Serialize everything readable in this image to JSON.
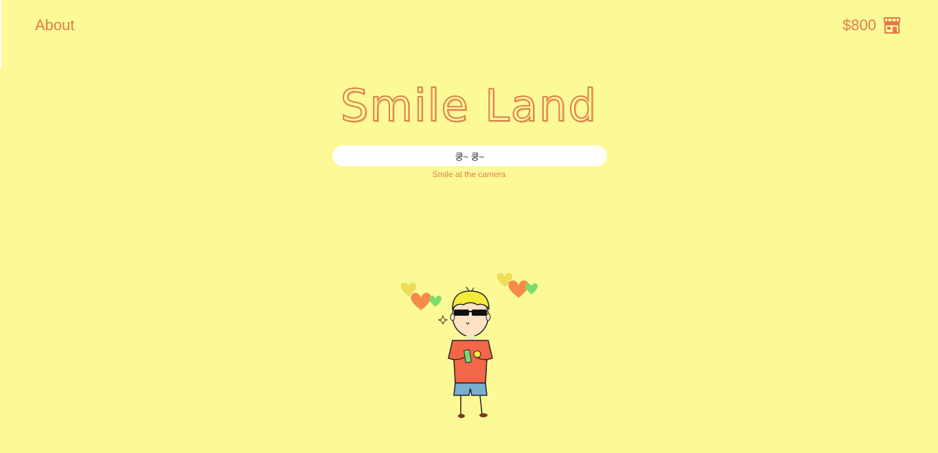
{
  "nav": {
    "about_label": "About",
    "money": "$800",
    "shop_icon": "shop-icon"
  },
  "title": "Smile Land",
  "message": "쿵~ 쿵~",
  "hint": "Smile at the camera",
  "colors": {
    "background": "#fcf997",
    "accent": "#e07c4b",
    "heart_yellow": "#eedc5a",
    "heart_orange": "#f58a4b",
    "heart_green": "#7ddb6a",
    "shirt": "#f2664a",
    "shorts": "#7aaed0",
    "hair": "#f5ec3a"
  }
}
